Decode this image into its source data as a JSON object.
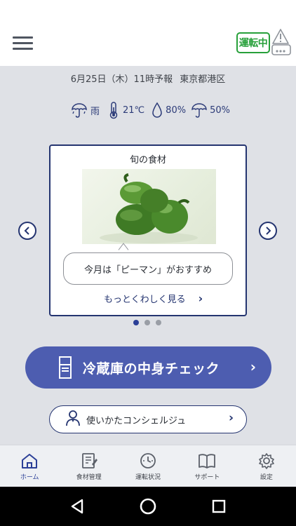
{
  "header": {
    "menu_icon": "hamburger-menu-icon",
    "status_badge": "運転中",
    "router_icon": "router-warning-icon"
  },
  "forecast": {
    "date_line": "6月25日（木）11時予報",
    "location": "東京都港区"
  },
  "weather": {
    "condition": "雨",
    "temperature": "21℃",
    "humidity": "80%",
    "rain_probability": "50%"
  },
  "card": {
    "title": "旬の食材",
    "message": "今月は「ピーマン」がおすすめ",
    "more_link": "もっとくわしく見る",
    "page_indicator": {
      "count": 3,
      "active": 0
    }
  },
  "actions": {
    "fridge_check_label": "冷蔵庫の中身チェック",
    "concierge_label": "使いかたコンシェルジュ"
  },
  "bottom_nav": {
    "items": [
      {
        "label": "ホーム",
        "icon": "home-icon",
        "active": true
      },
      {
        "label": "食材管理",
        "icon": "food-management-icon",
        "active": false
      },
      {
        "label": "運転状況",
        "icon": "operation-status-icon",
        "active": false
      },
      {
        "label": "サポート",
        "icon": "support-book-icon",
        "active": false
      },
      {
        "label": "設定",
        "icon": "settings-gear-icon",
        "active": false
      }
    ]
  },
  "colors": {
    "accent_navy": "#243470",
    "button_blue": "#4d5db0",
    "status_green": "#27a03a",
    "background": "#dfe1e6"
  }
}
